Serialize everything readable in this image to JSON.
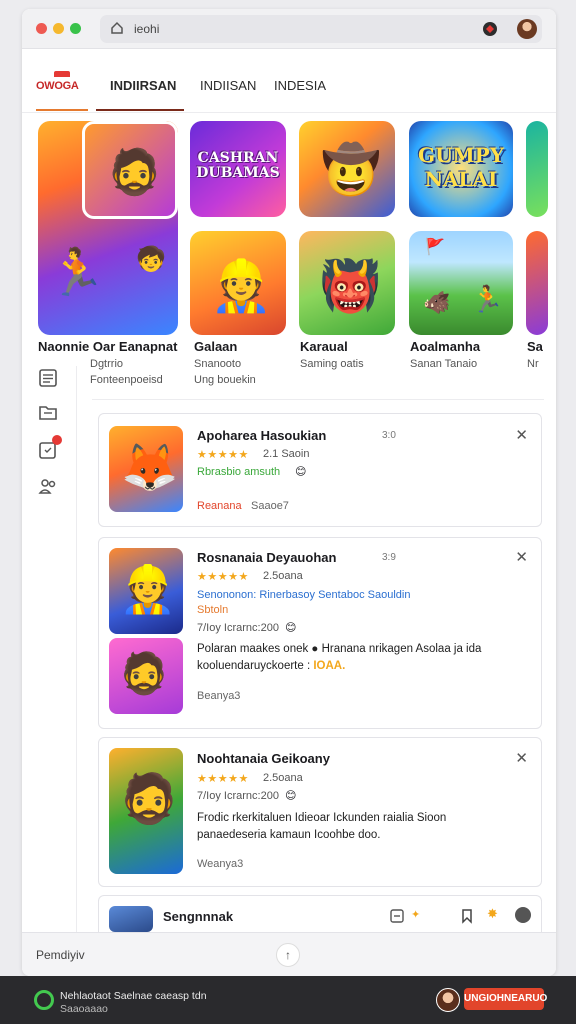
{
  "browser": {
    "address_text": "ieohi",
    "icons": [
      "home-icon",
      "extension-icon",
      "profile-avatar"
    ]
  },
  "nav": {
    "logo_text": "OWOGA",
    "tabs": [
      {
        "label": "INDIIRSAN"
      },
      {
        "label": "INDIISAN"
      },
      {
        "label": "INDESIA"
      }
    ]
  },
  "tiles": {
    "a_caption": "CASHRAN DUBAMAS",
    "c_caption": "GUMPY NALAI"
  },
  "featured": [
    {
      "title": "Naonnie Oar Eanapnat",
      "sub1": "Dgtrrio",
      "sub2": "Fonteenpoeisd"
    },
    {
      "title": "Galaan",
      "sub1": "Snanooto",
      "sub2": "Ung bouekin"
    },
    {
      "title": "Karaual",
      "sub1": "Saming oatis",
      "sub2": ""
    },
    {
      "title": "Aoalmanha",
      "sub1": "Sanan Tanaio",
      "sub2": ""
    },
    {
      "title": "Sa",
      "sub1": "Nr",
      "sub2": ""
    }
  ],
  "sidebar": {
    "icons": [
      "list-icon",
      "folder-icon",
      "notification-icon",
      "group-icon"
    ]
  },
  "cards": [
    {
      "title": "Apoharea Hasoukian",
      "size": "3:0",
      "stars": "★★★★★",
      "rating_count": "2.1 Saoin",
      "line1": "Rbrasbio amsuth",
      "footer_tag": "Reanana",
      "footer_text": "Saaoe7"
    },
    {
      "title": "Rosnanaia Deyauohan",
      "size": "3:9",
      "stars": "★★★★★",
      "rating_count": "2.5oana",
      "line1": "Senononon: Rinerbasoy Sentaboc Saouldin",
      "line2": "Sbtoln",
      "meta": "7/Ioy  Icrarnc:200",
      "desc1": "Polaran maakes onek ● Hranana nrikagen Asolaa ja ida",
      "desc2": "kooluendaruyckoerte : ",
      "desc_highlight": "IOAA.",
      "footer": "Beanya3"
    },
    {
      "title": "Noohtanaia Geikoany",
      "size": "",
      "stars": "★★★★★",
      "rating_count": "2.5oana",
      "meta": "7/Ioy  Icrarnc:200",
      "desc1": "Frodic rkerkitaluen Idieoar Ickunden raialia Sioon",
      "desc2": "panaedeseria kamaun Icoohbe doo.",
      "footer": "Weanya3"
    }
  ],
  "partial_card": {
    "title": "Sengnnnak"
  },
  "window_footer": {
    "text": "Pemdiyiv",
    "fab": "↑"
  },
  "system_bar": {
    "text1": "Nehlaotaot Saelnae caeasp tdn",
    "text2": "Saaoaaao",
    "button": "UNGIOHNEARUO"
  }
}
